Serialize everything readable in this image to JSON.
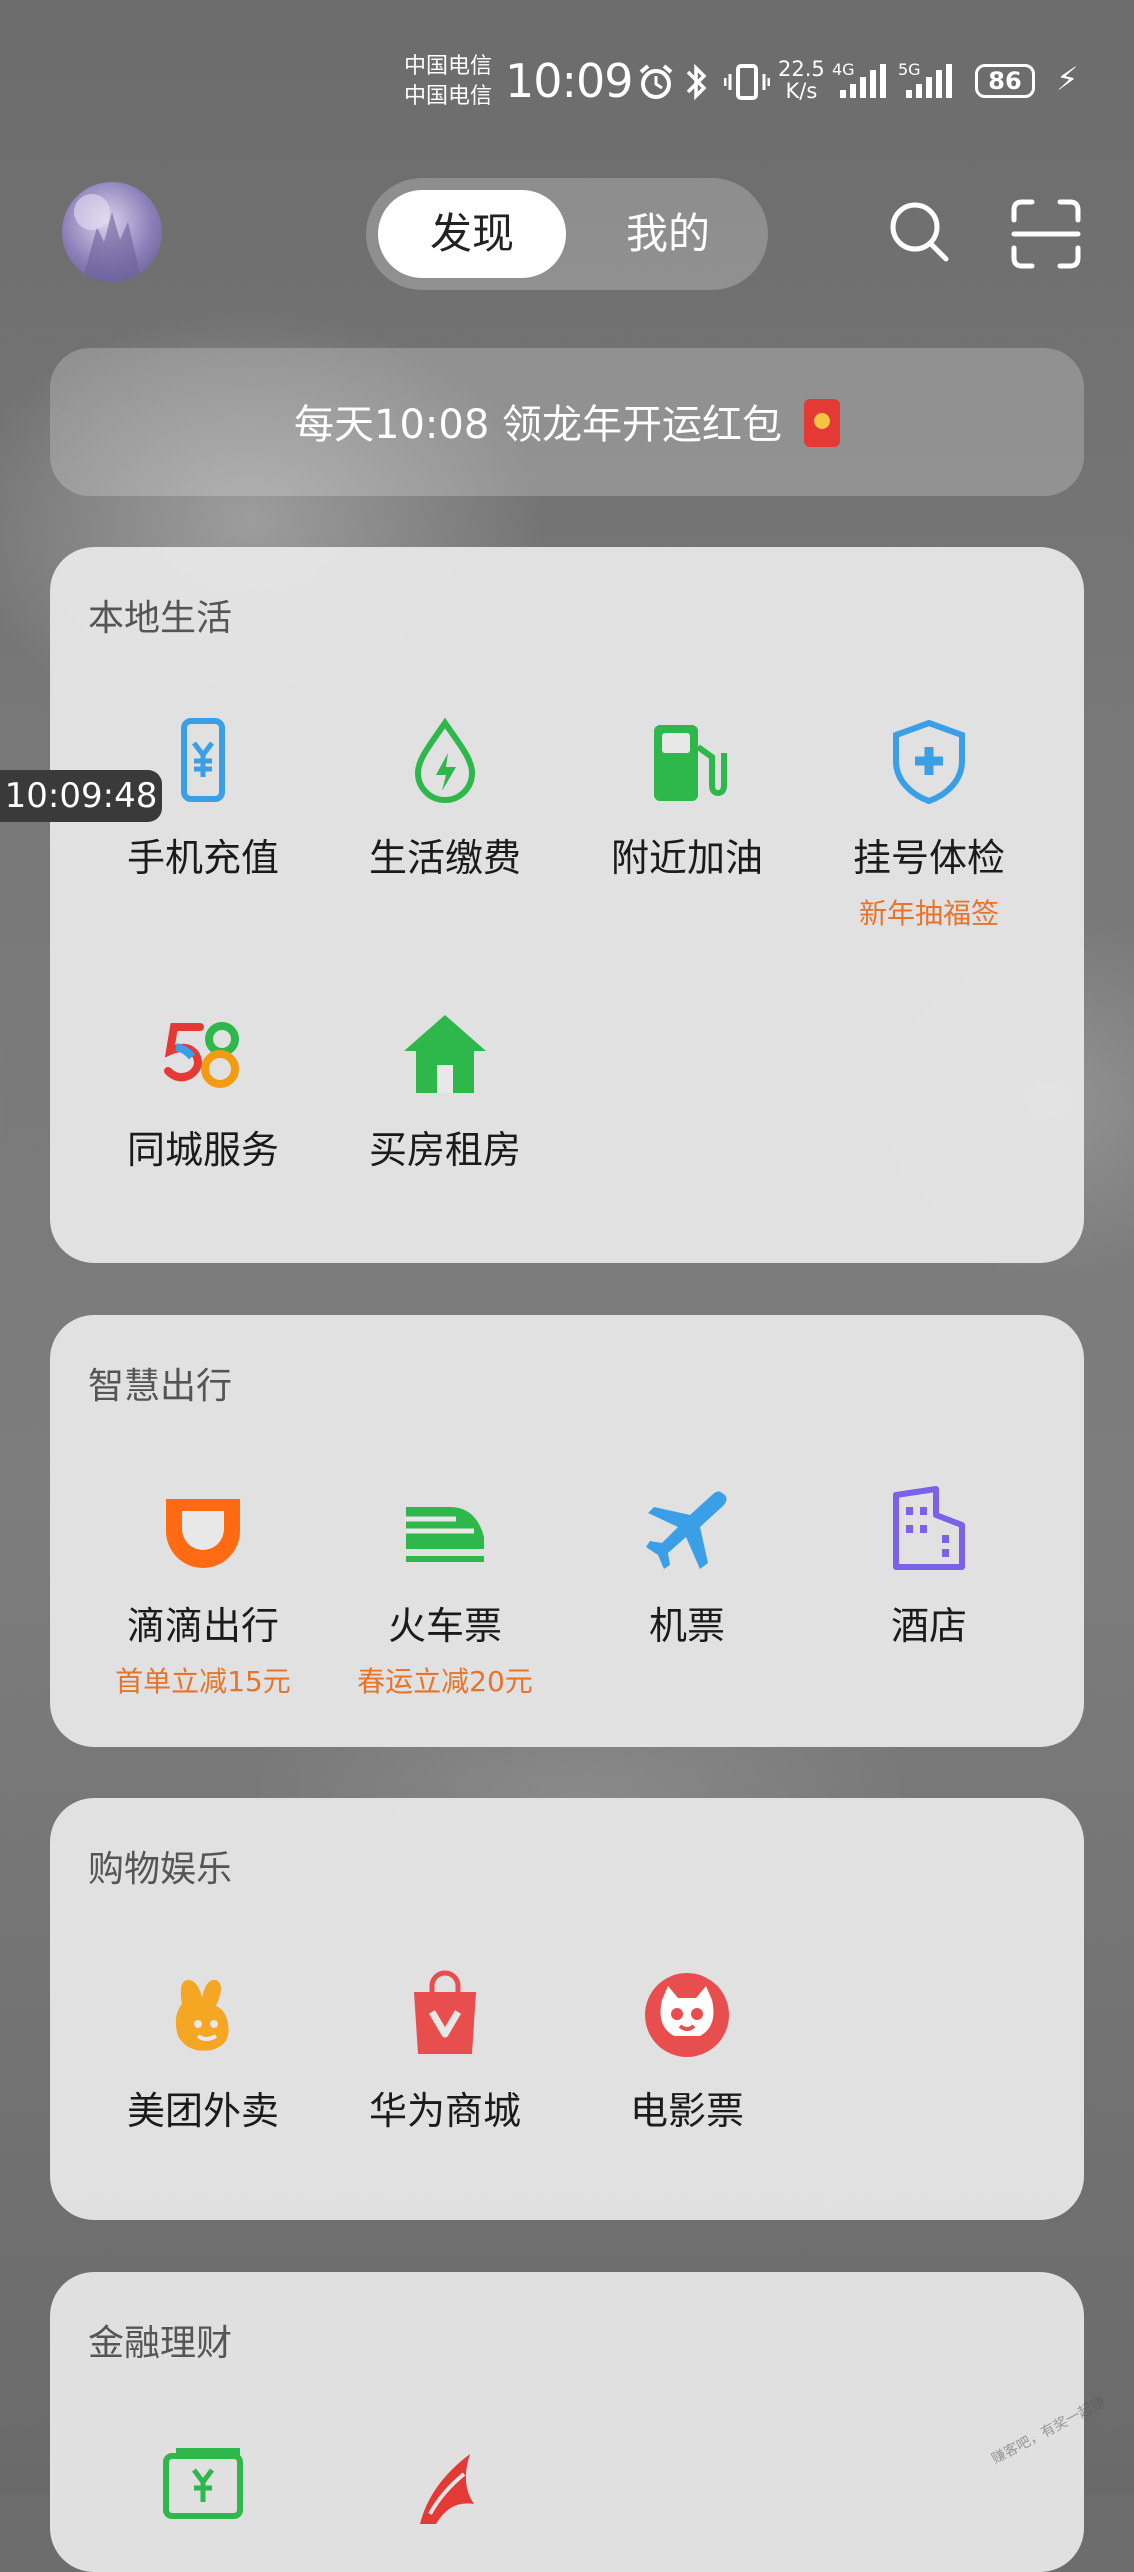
{
  "status_bar": {
    "carrier_1": "中国电信",
    "carrier_2": "中国电信",
    "time": "10:09",
    "speed_value": "22.5",
    "speed_unit": "K/s",
    "network_1": "4G",
    "network_2": "5G",
    "battery": "86"
  },
  "header": {
    "tabs": [
      {
        "label": "发现",
        "active": true
      },
      {
        "label": "我的",
        "active": false
      }
    ],
    "icons": [
      "search-icon",
      "scan-icon"
    ]
  },
  "banner": {
    "text": "每天10:08 领龙年开运红包"
  },
  "overlay": {
    "timestamp": "10:09:48"
  },
  "sections": [
    {
      "title": "本地生活",
      "items": [
        {
          "label": "手机充值",
          "sub": "",
          "icon": "phone-topup-icon"
        },
        {
          "label": "生活缴费",
          "sub": "",
          "icon": "utility-bill-icon"
        },
        {
          "label": "附近加油",
          "sub": "",
          "icon": "gas-station-icon"
        },
        {
          "label": "挂号体检",
          "sub": "新年抽福签",
          "icon": "medical-shield-icon"
        },
        {
          "label": "同城服务",
          "sub": "",
          "icon": "58-logo-icon"
        },
        {
          "label": "买房租房",
          "sub": "",
          "icon": "house-icon"
        }
      ]
    },
    {
      "title": "智慧出行",
      "items": [
        {
          "label": "滴滴出行",
          "sub": "首单立减15元",
          "icon": "didi-icon"
        },
        {
          "label": "火车票",
          "sub": "春运立减20元",
          "icon": "train-icon"
        },
        {
          "label": "机票",
          "sub": "",
          "icon": "airplane-icon"
        },
        {
          "label": "酒店",
          "sub": "",
          "icon": "hotel-icon"
        }
      ]
    },
    {
      "title": "购物娱乐",
      "items": [
        {
          "label": "美团外卖",
          "sub": "",
          "icon": "meituan-icon"
        },
        {
          "label": "华为商城",
          "sub": "",
          "icon": "shopping-bag-icon"
        },
        {
          "label": "电影票",
          "sub": "",
          "icon": "movie-cat-icon"
        }
      ]
    },
    {
      "title": "金融理财",
      "items": [
        {
          "label": "",
          "sub": "",
          "icon": "money-icon"
        },
        {
          "label": "",
          "sub": "",
          "icon": "finance-icon"
        }
      ]
    }
  ],
  "colors": {
    "accent_orange": "#e6742c",
    "card_bg": "#e8e8e8"
  }
}
